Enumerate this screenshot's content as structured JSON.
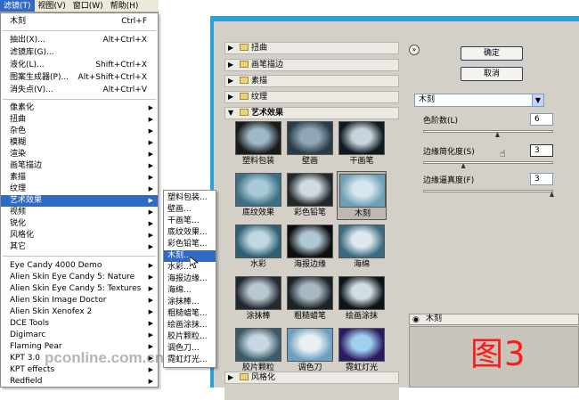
{
  "menubar": {
    "items": [
      "滤镜(T)",
      "视图(V)",
      "窗口(W)",
      "帮助(H)"
    ]
  },
  "filter_menu": {
    "items": [
      {
        "label": "木刻",
        "shortcut": "Ctrl+F"
      },
      {
        "label": "抽出(X)...",
        "shortcut": "Alt+Ctrl+X"
      },
      {
        "label": "滤镜库(G)...",
        "shortcut": ""
      },
      {
        "label": "液化(L)...",
        "shortcut": "Shift+Ctrl+X"
      },
      {
        "label": "图案生成器(P)...",
        "shortcut": "Alt+Shift+Ctrl+X"
      },
      {
        "label": "消失点(V)...",
        "shortcut": "Alt+Ctrl+V"
      },
      {
        "label": "像素化",
        "arrow": true
      },
      {
        "label": "扭曲",
        "arrow": true
      },
      {
        "label": "杂色",
        "arrow": true
      },
      {
        "label": "模糊",
        "arrow": true
      },
      {
        "label": "渲染",
        "arrow": true
      },
      {
        "label": "画笔描边",
        "arrow": true
      },
      {
        "label": "素描",
        "arrow": true
      },
      {
        "label": "纹理",
        "arrow": true
      },
      {
        "label": "艺术效果",
        "arrow": true
      },
      {
        "label": "视频",
        "arrow": true
      },
      {
        "label": "锐化",
        "arrow": true
      },
      {
        "label": "风格化",
        "arrow": true
      },
      {
        "label": "其它",
        "arrow": true
      },
      {
        "label": "Eye Candy 4000 Demo",
        "arrow": true
      },
      {
        "label": "Alien Skin Eye Candy 5: Nature",
        "arrow": true
      },
      {
        "label": "Alien Skin Eye Candy 5: Textures",
        "arrow": true
      },
      {
        "label": "Alien Skin Image Doctor",
        "arrow": true
      },
      {
        "label": "Alien Skin Xenofex 2",
        "arrow": true
      },
      {
        "label": "DCE Tools",
        "arrow": true
      },
      {
        "label": "Digimarc",
        "arrow": true
      },
      {
        "label": "Flaming Pear",
        "arrow": true
      },
      {
        "label": "KPT 3.0",
        "arrow": true
      },
      {
        "label": "KPT effects",
        "arrow": true
      },
      {
        "label": "Redfield",
        "arrow": true
      }
    ]
  },
  "submenu": {
    "items": [
      "塑料包装...",
      "壁画...",
      "干画笔...",
      "底纹效果...",
      "彩色铅笔...",
      "木刻...",
      "水彩...",
      "海报边缘...",
      "海绵...",
      "涂抹棒...",
      "粗糙蜡笔...",
      "绘画涂抹...",
      "胶片颗粒...",
      "调色刀...",
      "霓虹灯光..."
    ]
  },
  "gallery": {
    "categories_top": [
      "扭曲",
      "画笔描边",
      "素描",
      "纹理",
      "艺术效果"
    ],
    "category_bottom": "风格化",
    "thumbs": [
      "塑料包装",
      "壁画",
      "干画笔",
      "底纹效果",
      "彩色铅笔",
      "木刻",
      "水彩",
      "海报边缘",
      "海绵",
      "涂抹棒",
      "粗糙蜡笔",
      "绘画涂抹",
      "胶片颗粒",
      "调色刀",
      "霓虹灯光"
    ],
    "ok_label": "确定",
    "cancel_label": "取消",
    "filter_select": "木刻",
    "params": [
      {
        "label": "色阶数(L)",
        "value": "6",
        "level": 0.57
      },
      {
        "label": "边缘简化度(S)",
        "value": "3",
        "level": 0.3
      },
      {
        "label": "边缘逼真度(F)",
        "value": "3",
        "level": 1.0
      }
    ],
    "layer_label": "木刻"
  },
  "overlay_text": "图3",
  "watermark": "pconline.com.cn",
  "colors": {
    "highlight": "#316ac5",
    "frame": "#2ba0d8",
    "panel": "#d4d0c8",
    "red": "#ff1a1a"
  }
}
